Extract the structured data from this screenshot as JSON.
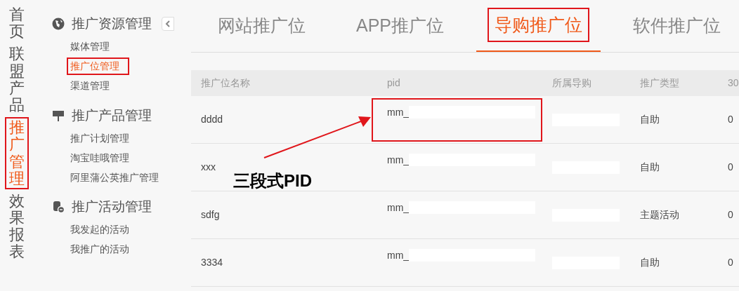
{
  "top_nav": [
    {
      "label": "首页",
      "selected": false,
      "annotated": false
    },
    {
      "label": "联盟产品",
      "selected": false,
      "annotated": false
    },
    {
      "label": "推广管理",
      "selected": true,
      "annotated": true
    },
    {
      "label": "效果报表",
      "selected": false,
      "annotated": false
    }
  ],
  "sidebar": {
    "sections": [
      {
        "title": "推广资源管理",
        "items": [
          {
            "label": "媒体管理",
            "selected": false,
            "annotated": false
          },
          {
            "label": "推广位管理",
            "selected": true,
            "annotated": true
          },
          {
            "label": "渠道管理",
            "selected": false,
            "annotated": false
          }
        ]
      },
      {
        "title": "推广产品管理",
        "items": [
          {
            "label": "推广计划管理",
            "selected": false,
            "annotated": false
          },
          {
            "label": "淘宝哇哦管理",
            "selected": false,
            "annotated": false
          },
          {
            "label": "阿里蒲公英推广管理",
            "selected": false,
            "annotated": false
          }
        ]
      },
      {
        "title": "推广活动管理",
        "items": [
          {
            "label": "我发起的活动",
            "selected": false,
            "annotated": false
          },
          {
            "label": "我推广的活动",
            "selected": false,
            "annotated": false
          }
        ]
      }
    ]
  },
  "tabs": [
    {
      "label": "网站推广位",
      "selected": false,
      "annotated": false
    },
    {
      "label": "APP推广位",
      "selected": false,
      "annotated": false
    },
    {
      "label": "导购推广位",
      "selected": true,
      "annotated": true
    },
    {
      "label": "软件推广位",
      "selected": false,
      "annotated": false
    }
  ],
  "table": {
    "columns": [
      "推广位名称",
      "pid",
      "所属导购",
      "推广类型",
      "30"
    ],
    "rows": [
      {
        "name": "dddd",
        "pid": "mm_",
        "type": "自助",
        "column_5": "0",
        "annotated": true
      },
      {
        "name": "xxx",
        "pid": "mm_",
        "type": "自助",
        "column_5": "0",
        "annotated": false
      },
      {
        "name": "sdfg",
        "pid": "mm_",
        "type": "主题活动",
        "column_5": "0",
        "annotated": false
      },
      {
        "name": "3334",
        "pid": "mm_",
        "type": "自助",
        "column_5": "0",
        "annotated": false
      }
    ]
  },
  "annotation": {
    "label": "三段式PID"
  }
}
